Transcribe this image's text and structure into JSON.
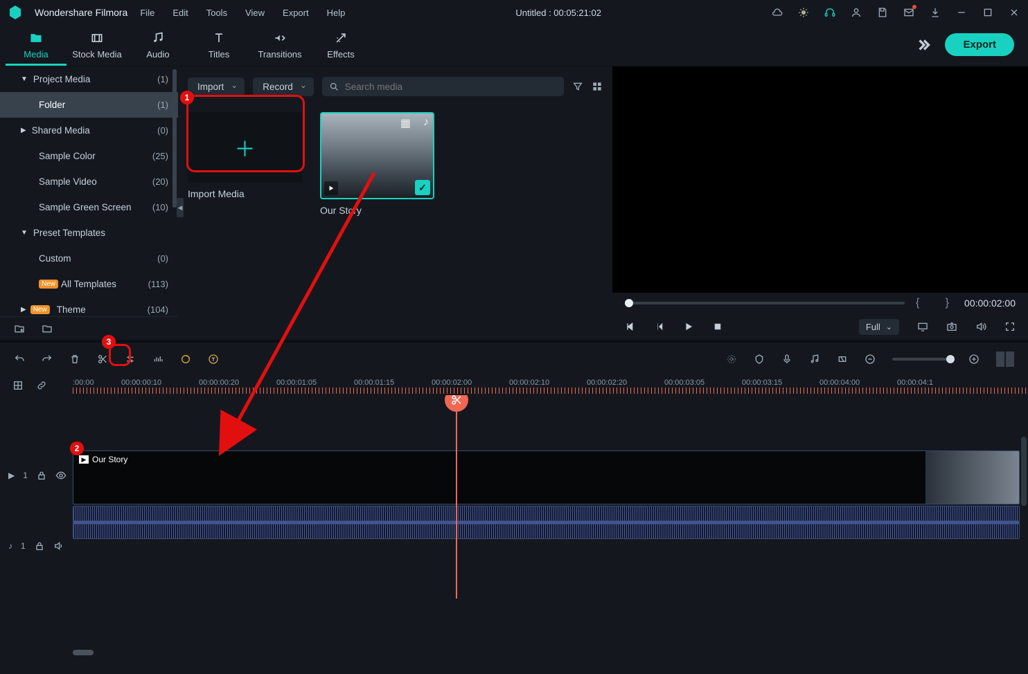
{
  "app": {
    "name": "Wondershare Filmora",
    "document": "Untitled : 00:05:21:02"
  },
  "menus": [
    "File",
    "Edit",
    "Tools",
    "View",
    "Export",
    "Help"
  ],
  "tabs": [
    {
      "label": "Media"
    },
    {
      "label": "Stock Media"
    },
    {
      "label": "Audio"
    },
    {
      "label": "Titles"
    },
    {
      "label": "Transitions"
    },
    {
      "label": "Effects"
    }
  ],
  "export_label": "Export",
  "sidebar": [
    {
      "label": "Project Media",
      "count": "(1)",
      "lvl": 0,
      "open": true
    },
    {
      "label": "Folder",
      "count": "(1)",
      "lvl": 1,
      "selected": true
    },
    {
      "label": "Shared Media",
      "count": "(0)",
      "lvl": 0,
      "closed": true
    },
    {
      "label": "Sample Color",
      "count": "(25)",
      "lvl": 1
    },
    {
      "label": "Sample Video",
      "count": "(20)",
      "lvl": 1
    },
    {
      "label": "Sample Green Screen",
      "count": "(10)",
      "lvl": 1
    },
    {
      "label": "Preset Templates",
      "count": "",
      "lvl": 0,
      "open": true
    },
    {
      "label": "Custom",
      "count": "(0)",
      "lvl": 1
    },
    {
      "label": "All Templates",
      "count": "(113)",
      "lvl": 1,
      "new": true
    },
    {
      "label": "Theme",
      "count": "(104)",
      "lvl": 0,
      "new": true,
      "closed": true
    }
  ],
  "media_pane": {
    "import_label": "Import",
    "record_label": "Record",
    "search_placeholder": "Search media",
    "import_card_label": "Import Media",
    "clip_name": "Our Story"
  },
  "preview": {
    "timecode": "00:00:02:00",
    "quality": "Full"
  },
  "timeline": {
    "marks": [
      ":00:00",
      "00:00:00:10",
      "00:00:00:20",
      "00:00:01:05",
      "00:00:01:15",
      "00:00:02:00",
      "00:00:02:10",
      "00:00:02:20",
      "00:00:03:05",
      "00:00:03:15",
      "00:00:04:00",
      "00:00:04:1"
    ],
    "clip_label": "Our Story",
    "video_track_label": "1",
    "audio_track_label": "1"
  },
  "annotations": {
    "one": "1",
    "two": "2",
    "three": "3"
  }
}
